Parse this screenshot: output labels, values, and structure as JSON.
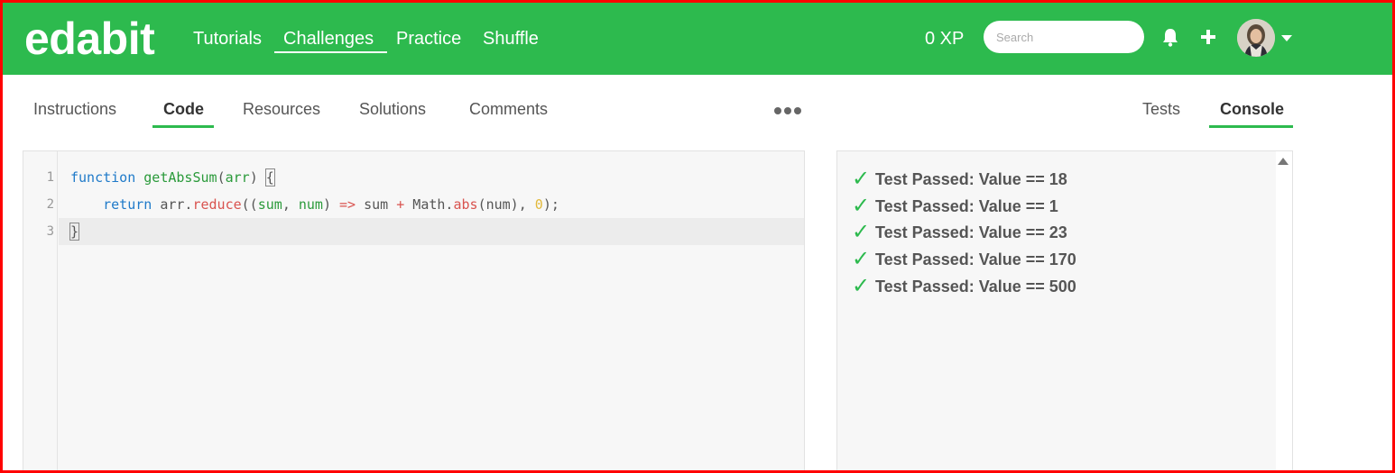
{
  "header": {
    "logo": "edabit",
    "nav": [
      "Tutorials",
      "Challenges",
      "Practice",
      "Shuffle"
    ],
    "active_nav": "Challenges",
    "xp": "0 XP",
    "search_placeholder": "Search",
    "icons": [
      "bell-icon",
      "plus-icon",
      "avatar",
      "chevron-down-icon"
    ],
    "accent": "#2dba4e"
  },
  "tabs": {
    "left": [
      "Instructions",
      "Code",
      "Resources",
      "Solutions",
      "Comments"
    ],
    "left_active": "Code",
    "more_icon": "more-dots-icon",
    "right": [
      "Tests",
      "Console"
    ],
    "right_active": "Console"
  },
  "editor": {
    "line_numbers": [
      "1",
      "2",
      "3"
    ],
    "lines": [
      "function getAbsSum(arr) {",
      "    return arr.reduce((sum, num) => sum + Math.abs(num), 0);",
      "}"
    ]
  },
  "console": {
    "results": [
      "Test Passed: Value == 18",
      "Test Passed: Value == 1",
      "Test Passed: Value == 23",
      "Test Passed: Value == 170",
      "Test Passed: Value == 500"
    ],
    "check_icon": "check-icon"
  }
}
